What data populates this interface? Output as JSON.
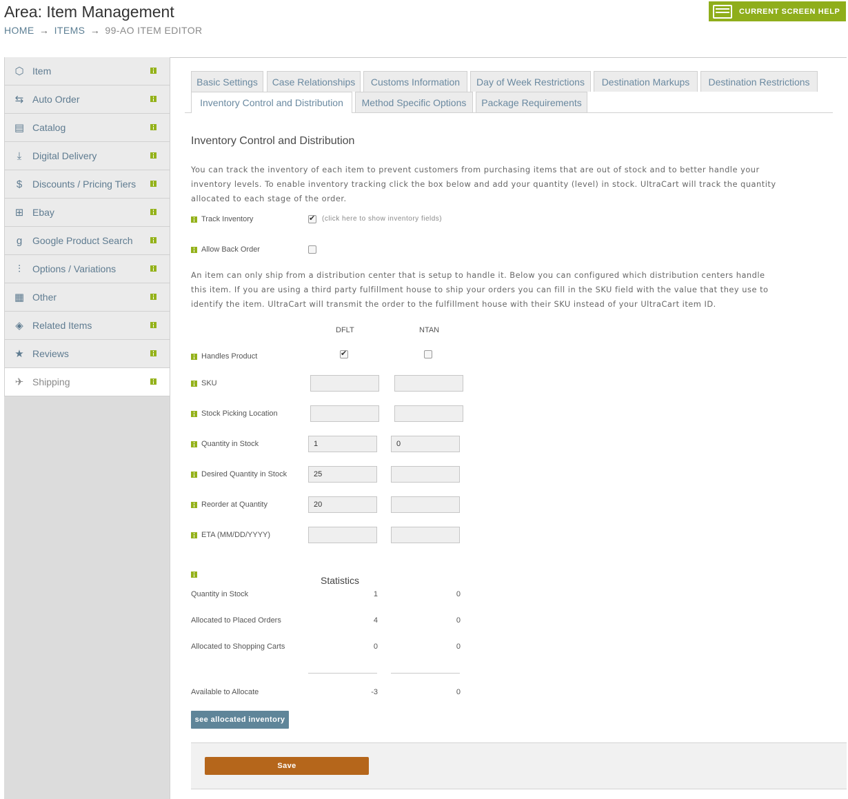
{
  "header": {
    "title": "Area: Item Management",
    "breadcrumb": [
      "HOME",
      "ITEMS",
      "99-AO ITEM EDITOR"
    ],
    "arrow": "→",
    "help_label": "CURRENT SCREEN HELP"
  },
  "sidebar": {
    "items": [
      {
        "label": "Item",
        "icon": "cube-icon"
      },
      {
        "label": "Auto Order",
        "icon": "repeat-icon"
      },
      {
        "label": "Catalog",
        "icon": "catalog-icon"
      },
      {
        "label": "Digital Delivery",
        "icon": "download-icon"
      },
      {
        "label": "Discounts / Pricing Tiers",
        "icon": "dollar-icon"
      },
      {
        "label": "Ebay",
        "icon": "columns-icon"
      },
      {
        "label": "Google Product Search",
        "icon": "google-icon"
      },
      {
        "label": "Options / Variations",
        "icon": "sliders-icon"
      },
      {
        "label": "Other",
        "icon": "document-icon"
      },
      {
        "label": "Related Items",
        "icon": "boxes-icon"
      },
      {
        "label": "Reviews",
        "icon": "star-icon"
      },
      {
        "label": "Shipping",
        "icon": "plane-icon"
      }
    ],
    "active": "Shipping"
  },
  "tabs": {
    "row1": [
      "Basic Settings",
      "Case Relationships",
      "Customs Information",
      "Day of Week Restrictions",
      "Destination Markups",
      "Destination Restrictions"
    ],
    "row2": [
      "Inventory Control and Distribution",
      "Method Specific Options",
      "Package Requirements"
    ],
    "active": "Inventory Control and Distribution"
  },
  "content": {
    "title": "Inventory Control and Distribution",
    "intro_lines": [
      "You can track the inventory of each item to prevent customers from purchasing items that are out of stock and to better handle your",
      "inventory levels. To enable inventory tracking click the box below and add your quantity (level) in stock. UltraCart will track the quantity",
      "allocated to each stage of the order."
    ],
    "track_inventory_label": "Track Inventory",
    "track_inventory_checked": true,
    "track_inventory_note": "(click here to show inventory fields)",
    "allow_back_order_label": "Allow Back Order",
    "allow_back_order_checked": false,
    "dist_lines": [
      "An item can only ship from a distribution center that is setup to handle it. Below you can configured which distribution centers handle",
      "this item. If you are using a third party fulfillment house to ship your orders you can fill in the SKU field with the value that they use to",
      "identify the item. UltraCart will transmit the order to the fulfillment house with their SKU instead of your UltraCart item ID."
    ],
    "columns": [
      "DFLT",
      "NTAN"
    ],
    "handles_product_label": "Handles Product",
    "handles_product": [
      true,
      false
    ],
    "sku_label": "SKU",
    "sku": [
      "",
      ""
    ],
    "stock_picking_label": "Stock Picking Location",
    "stock_picking": [
      "",
      ""
    ],
    "qty_in_stock_label": "Quantity in Stock",
    "qty_in_stock": [
      "1",
      "0"
    ],
    "desired_qty_label": "Desired Quantity in Stock",
    "desired_qty": [
      "25",
      ""
    ],
    "reorder_label": "Reorder at Quantity",
    "reorder": [
      "20",
      ""
    ],
    "eta_label": "ETA (MM/DD/YYYY)",
    "eta": [
      "",
      ""
    ]
  },
  "statistics": {
    "title": "Statistics",
    "rows": [
      {
        "label": "Quantity in Stock",
        "dflt": "1",
        "ntan": "0"
      },
      {
        "label": "Allocated to Placed Orders",
        "dflt": "4",
        "ntan": "0"
      },
      {
        "label": "Allocated to Shopping Carts",
        "dflt": "0",
        "ntan": "0"
      }
    ],
    "available": {
      "label": "Available to Allocate",
      "dflt": "-3",
      "ntan": "0"
    }
  },
  "buttons": {
    "see_allocated": "see allocated inventory",
    "save": "Save"
  },
  "colors": {
    "accent_green": "#94b21b",
    "link_blue": "#5e7b90",
    "save_orange": "#b5661b",
    "button_blue": "#5f8599"
  }
}
